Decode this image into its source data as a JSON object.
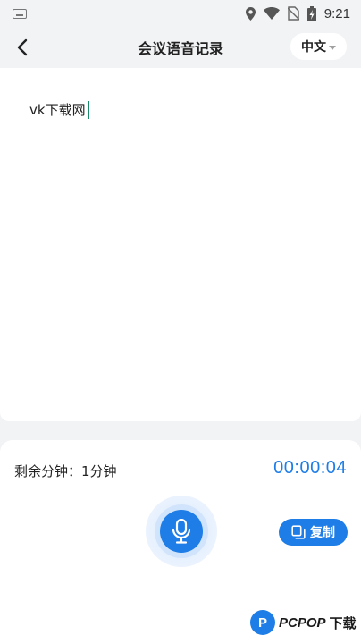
{
  "status_bar": {
    "time": "9:21",
    "icons": [
      "keyboard-icon",
      "location-icon",
      "wifi-icon",
      "no-sim-icon",
      "battery-charging-icon"
    ]
  },
  "header": {
    "title": "会议语音记录",
    "language": "中文"
  },
  "editor": {
    "text": "vk下载网"
  },
  "panel": {
    "remaining_label": "剩余分钟：1分钟",
    "timer": "00:00:04",
    "copy_label": "复制"
  },
  "watermark": {
    "text": "PCPOP",
    "text_suffix": "下载",
    "logo_letter": "P"
  },
  "colors": {
    "accent": "#1e7de6",
    "cursor": "#1a8a6a",
    "background": "#f2f3f5"
  }
}
